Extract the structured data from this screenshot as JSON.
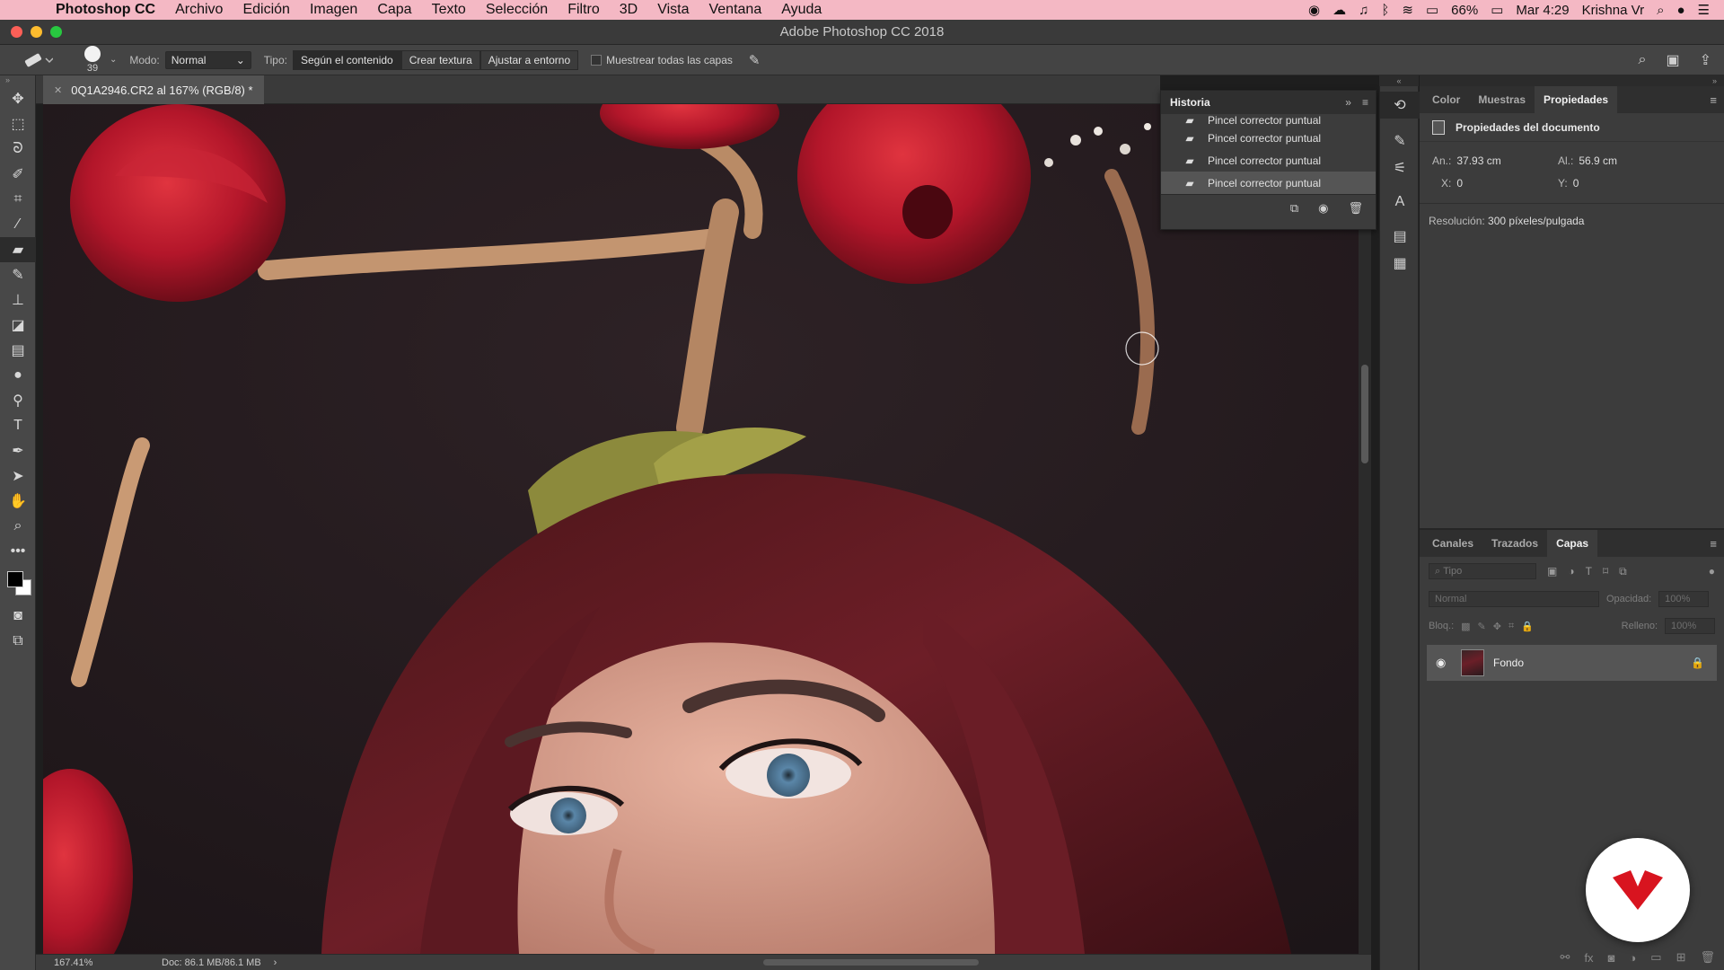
{
  "menubar": {
    "app_name": "Photoshop CC",
    "items": [
      "Archivo",
      "Edición",
      "Imagen",
      "Capa",
      "Texto",
      "Selección",
      "Filtro",
      "3D",
      "Vista",
      "Ventana",
      "Ayuda"
    ],
    "battery": "66%",
    "clock": "Mar 4:29",
    "user": "Krishna Vr",
    "background_color": "#f4b8c4"
  },
  "window": {
    "title": "Adobe Photoshop CC 2018"
  },
  "options_bar": {
    "brush_size": "39",
    "mode_label": "Modo:",
    "mode_value": "Normal",
    "type_label": "Tipo:",
    "type_options": [
      "Según el contenido",
      "Crear textura",
      "Ajustar a entorno"
    ],
    "type_selected": "Según el contenido",
    "sample_all_label": "Muestrear todas las capas",
    "sample_all_checked": false
  },
  "toolbar": {
    "tools": [
      "move-icon",
      "marquee-icon",
      "lasso-icon",
      "quick-select-icon",
      "crop-icon",
      "eyedropper-icon",
      "spot-healing-icon",
      "brush-icon",
      "stamp-icon",
      "eraser-icon",
      "gradient-icon",
      "blur-icon",
      "dodge-icon",
      "type-icon",
      "pen-icon",
      "path-select-icon",
      "hand-icon",
      "zoom-icon",
      "more-icon"
    ],
    "active_tool": "spot-healing-icon",
    "foreground_color": "#000000",
    "background_color": "#ffffff"
  },
  "document": {
    "tab_label": "0Q1A2946.CR2 al 167% (RGB/8) *",
    "zoom": "167.41%",
    "doc_size": "Doc: 86.1 MB/86.1 MB"
  },
  "history": {
    "title": "Historia",
    "items": [
      "Pincel corrector puntual",
      "Pincel corrector puntual",
      "Pincel corrector puntual",
      "Pincel corrector puntual"
    ],
    "selected_index": 3
  },
  "properties_panel": {
    "tabs": [
      "Color",
      "Muestras",
      "Propiedades"
    ],
    "active_tab": "Propiedades",
    "section_title": "Propiedades del documento",
    "width_label": "An.:",
    "width_value": "37.93 cm",
    "height_label": "Al.:",
    "height_value": "56.9 cm",
    "x_label": "X:",
    "x_value": "0",
    "y_label": "Y:",
    "y_value": "0",
    "resolution_label": "Resolución:",
    "resolution_value": "300 píxeles/pulgada"
  },
  "layers_panel": {
    "tabs": [
      "Canales",
      "Trazados",
      "Capas"
    ],
    "active_tab": "Capas",
    "filter_placeholder": "Tipo",
    "blend_mode": "Normal",
    "opacity_label": "Opacidad:",
    "opacity_value": "100%",
    "lock_label": "Bloq.:",
    "fill_label": "Relleno:",
    "fill_value": "100%",
    "layers": [
      {
        "name": "Fondo",
        "visible": true,
        "locked": true
      }
    ]
  }
}
